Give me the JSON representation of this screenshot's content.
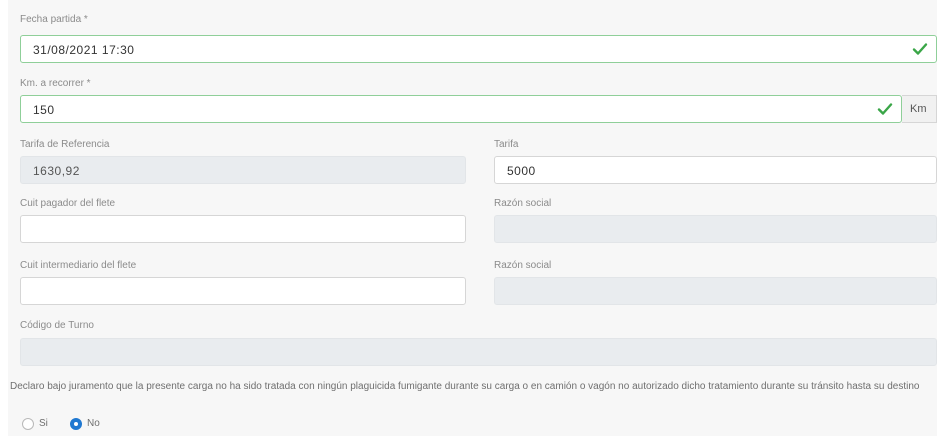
{
  "form": {
    "fecha_partida": {
      "label": "Fecha partida *",
      "value": "31/08/2021 17:30"
    },
    "km_recorrer": {
      "label": "Km. a recorrer *",
      "value": "150",
      "unit": "Km"
    },
    "tarifa_referencia": {
      "label": "Tarifa de Referencia",
      "value": "1630,92"
    },
    "tarifa": {
      "label": "Tarifa",
      "value": "5000"
    },
    "cuit_pagador": {
      "label": "Cuit pagador del flete",
      "value": ""
    },
    "razon_social_pagador": {
      "label": "Razón social",
      "value": ""
    },
    "cuit_intermediario": {
      "label": "Cuit intermediario del flete",
      "value": ""
    },
    "razon_social_intermediario": {
      "label": "Razón social",
      "value": ""
    },
    "codigo_turno": {
      "label": "Código de Turno",
      "value": ""
    },
    "declaracion": {
      "text": "Declaro bajo juramento que la presente carga no ha sido tratada con ningún plaguicida fumigante durante su carga o en camión o vagón no autorizado dicho tratamiento durante su tránsito hasta su destino",
      "options": [
        {
          "label": "Si",
          "checked": false
        },
        {
          "label": "No",
          "checked": true
        }
      ]
    }
  },
  "colors": {
    "valid_border": "#8fcf99",
    "check": "#3aa648",
    "radio_selected": "#1f78d1",
    "disabled_bg": "#e9ecef"
  },
  "icons": {
    "valid": "check-icon"
  }
}
